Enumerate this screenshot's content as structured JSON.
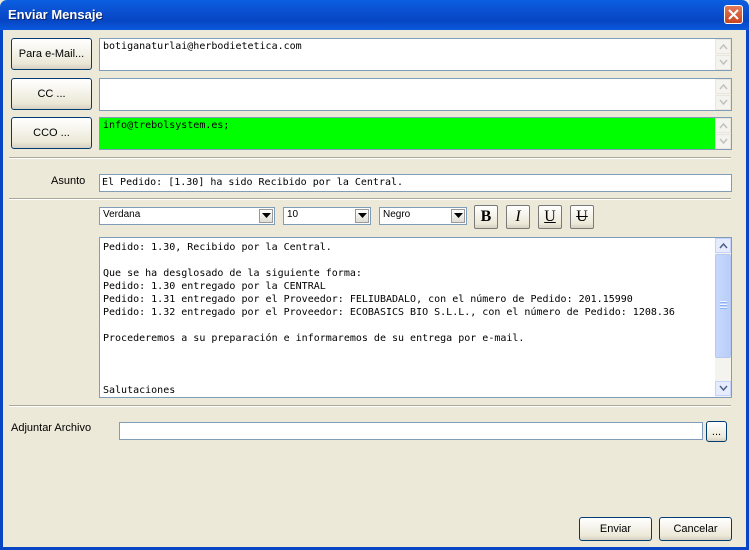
{
  "window": {
    "title": "Enviar Mensaje"
  },
  "recipients": {
    "para_label": "Para e-Mail...",
    "para_value": "botiganaturlai@herbodietetica.com",
    "cc_label": "CC ...",
    "cc_value": "",
    "cco_label": "CCO ...",
    "cco_value": "info@trebolsystem.es;",
    "cco_bg": "#00ff00"
  },
  "subject": {
    "label": "Asunto",
    "value": "El Pedido: [1.30] ha sido Recibido por la Central."
  },
  "format": {
    "font": "Verdana",
    "size": "10",
    "color": "Negro",
    "bold": "B",
    "italic": "I",
    "underline": "U",
    "strikethrough": "U"
  },
  "body": {
    "text": "Pedido: 1.30, Recibido por la Central.\n\nQue se ha desglosado de la siguiente forma:\nPedido: 1.30 entregado por la CENTRAL\nPedido: 1.31 entregado por el Proveedor: FELIUBADALO, con el número de Pedido: 201.15990\nPedido: 1.32 entregado por el Proveedor: ECOBASICS BIO S.L.L., con el número de Pedido: 1208.36\n\nProcederemos a su preparación e informaremos de su entrega por e-mail.\n\n\n\nSalutaciones"
  },
  "attachment": {
    "label": "Adjuntar Archivo",
    "value": "",
    "browse_label": "..."
  },
  "actions": {
    "send": "Enviar",
    "cancel": "Cancelar"
  }
}
